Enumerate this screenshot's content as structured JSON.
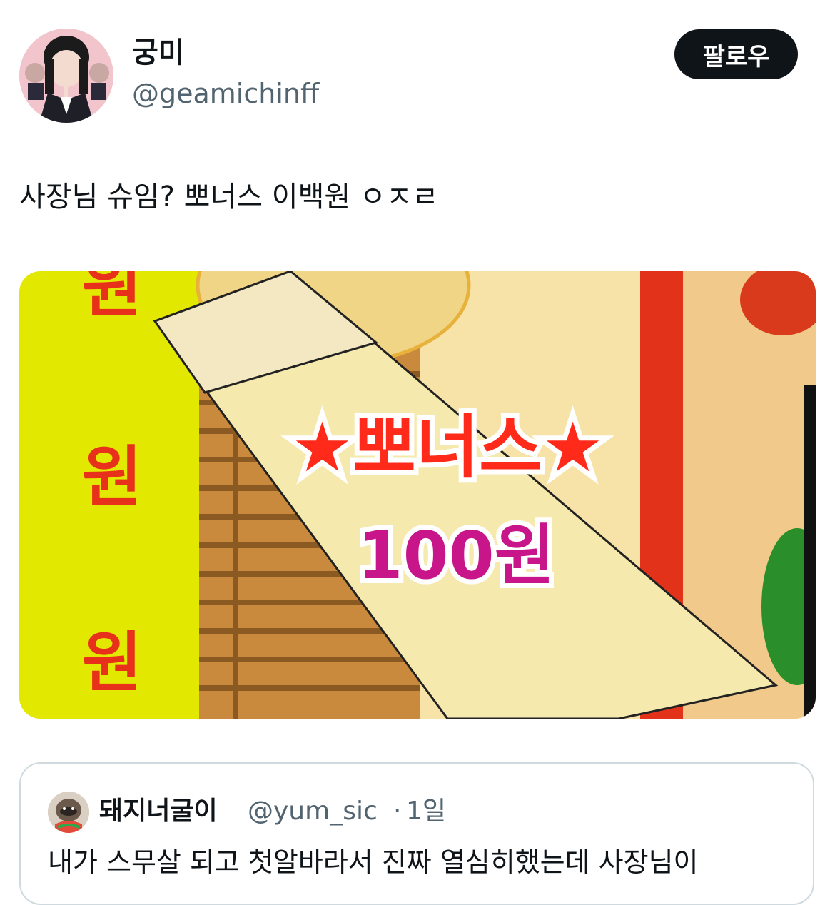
{
  "author": {
    "display_name": "궁미",
    "handle": "@geamichinff"
  },
  "follow_label": "팔로우",
  "tweet_text": "사장님 슈임? 뽀너스 이백원 ㅇㅈㄹ",
  "media": {
    "side_text": [
      "원",
      "원",
      "원"
    ],
    "bonus_text": "★뽀너스★",
    "amount_text": "100원"
  },
  "quote": {
    "display_name": "돼지너굴이",
    "handle": "@yum_sic",
    "separator": "·",
    "time": "1일",
    "text": "내가 스무살 되고 첫알바라서 진짜 열심히했는데 사장님이"
  },
  "colors": {
    "text": "#0f1419",
    "secondary": "#536471",
    "button_bg": "#0f1419",
    "border": "#cfd9de"
  }
}
